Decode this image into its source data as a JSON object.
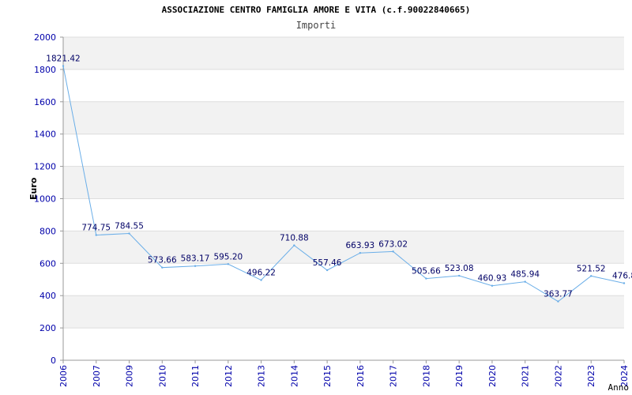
{
  "chart_data": {
    "type": "line",
    "title": "ASSOCIAZIONE CENTRO FAMIGLIA AMORE E VITA (c.f.90022840665)",
    "subtitle": "Importi",
    "ylabel": "Euro",
    "xlabel": "Anno",
    "ylim": [
      0,
      2000
    ],
    "yticks": [
      0,
      200,
      400,
      600,
      800,
      1000,
      1200,
      1400,
      1600,
      1800,
      2000
    ],
    "grid": true,
    "categories": [
      "2006",
      "2007",
      "2009",
      "2010",
      "2011",
      "2012",
      "2013",
      "2014",
      "2015",
      "2016",
      "2017",
      "2018",
      "2019",
      "2020",
      "2021",
      "2022",
      "2023",
      "2024"
    ],
    "values": [
      1821.42,
      774.75,
      784.55,
      573.66,
      583.17,
      595.2,
      496.22,
      710.88,
      557.46,
      663.93,
      673.02,
      505.66,
      523.08,
      460.93,
      485.94,
      363.77,
      521.52,
      476.8
    ],
    "labels": [
      "1821.42",
      "774.75",
      "784.55",
      "573.66",
      "583.17",
      "595.20",
      "496.22",
      "710.88",
      "557.46",
      "663.93",
      "673.02",
      "505.66",
      "523.08",
      "460.93",
      "485.94",
      "363.77",
      "521.52",
      "476.8"
    ],
    "colors": {
      "line": "#6aaee8",
      "band": "#f2f2f2",
      "gridline": "#dddddd",
      "tick_text": "#0000aa",
      "label_text": "#000066"
    }
  }
}
